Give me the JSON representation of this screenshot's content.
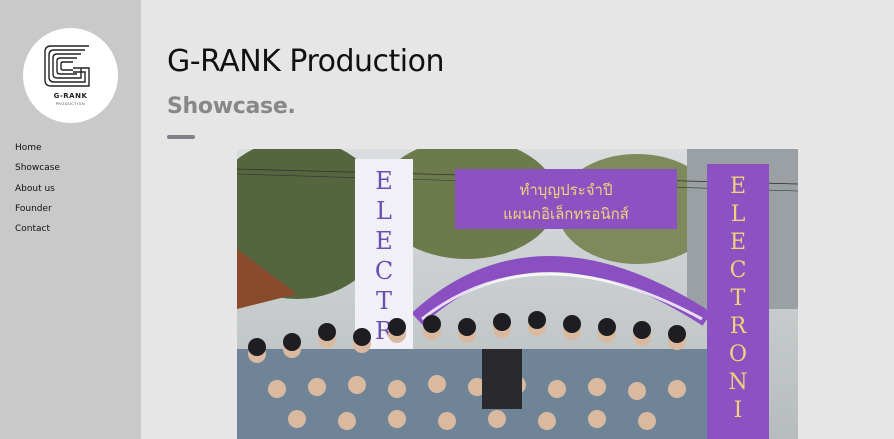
{
  "sidebar": {
    "logo": {
      "text": "G-RANK",
      "subtext": "PRODUCTION"
    },
    "nav_items": [
      {
        "label": "Home"
      },
      {
        "label": "Showcase"
      },
      {
        "label": "About us"
      },
      {
        "label": "Founder"
      },
      {
        "label": "Contact"
      }
    ]
  },
  "main": {
    "title": "G-RANK Production",
    "subtitle": "Showcase.",
    "accent_color": "#84818b",
    "photo": {
      "banner_center": "ทำบุญประจำปี แผนกอิเล็กทรอนิกส์",
      "banner_left": "ELECTRO",
      "banner_right": "ELECTRONIC"
    }
  }
}
